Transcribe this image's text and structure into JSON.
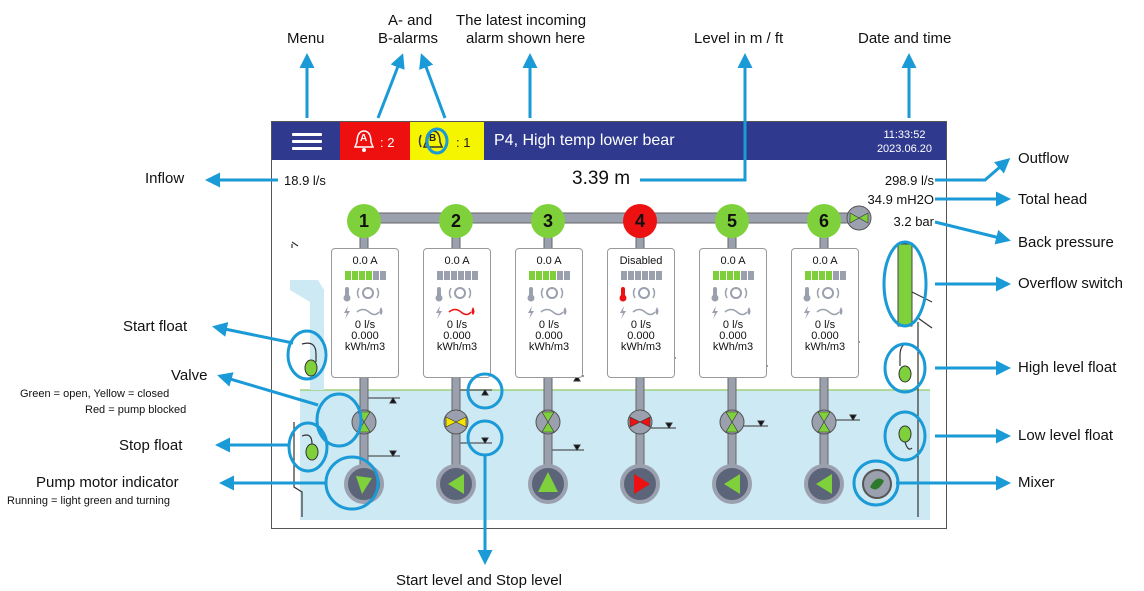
{
  "callouts": {
    "menu": "Menu",
    "alarms": [
      "A- and",
      "B-alarms"
    ],
    "latest_alarm": [
      "The latest incoming",
      "alarm shown here"
    ],
    "level": "Level in m / ft",
    "datetime": "Date and time",
    "inflow": "Inflow",
    "outflow": "Outflow",
    "total_head": "Total head",
    "back_pressure": "Back pressure",
    "overflow_switch": "Overflow switch",
    "start_float": "Start float",
    "valve": "Valve",
    "valve_legend_1": "Green = open, Yellow = closed",
    "valve_legend_2": "Red = pump blocked",
    "stop_float": "Stop float",
    "pump_motor": "Pump motor indicator",
    "pump_motor_legend": "Running = light green and turning",
    "high_float": "High level float",
    "low_float": "Low level float",
    "mixer": "Mixer",
    "start_stop_level": "Start level and Stop level"
  },
  "header": {
    "alarm_a_icon": "A",
    "alarm_a_count": ": 2",
    "alarm_b_icon": "B",
    "alarm_b_count": ": 1",
    "latest_alarm": "P4, High temp lower bear",
    "time": "11:33:52",
    "date": "2023.06.20"
  },
  "readings": {
    "inflow": "18.9 l/s",
    "level": "3.39 m",
    "outflow": "298.9 l/s",
    "total_head": "34.9 mH2O",
    "back_pressure": "3.2 bar"
  },
  "colors": {
    "topbar": "#2f3a8f",
    "alarm_a": "#ee0f0f",
    "alarm_b": "#f5f500",
    "pump_ok": "#7fd13b",
    "pump_alarm": "#ee1111",
    "water": "#cde9f3",
    "valve_open": "#7fd13b",
    "valve_closed": "#f5e400",
    "valve_blocked": "#ee1111",
    "callout": "#1a9ad6"
  },
  "pumps": [
    {
      "number": "1",
      "status_color": "#7fd13b",
      "current": "0.0 A",
      "bars_on": 4,
      "flow": "0 l/s",
      "energy": "0.000",
      "energy_unit": "kWh/m3",
      "valve": "open",
      "motor": "running",
      "warn": false
    },
    {
      "number": "2",
      "status_color": "#7fd13b",
      "current": "0.0 A",
      "bars_on": 0,
      "flow": "0 l/s",
      "energy": "0.000",
      "energy_unit": "kWh/m3",
      "valve": "closed",
      "motor": "stopped",
      "warn": true
    },
    {
      "number": "3",
      "status_color": "#7fd13b",
      "current": "0.0 A",
      "bars_on": 4,
      "flow": "0 l/s",
      "energy": "0.000",
      "energy_unit": "kWh/m3",
      "valve": "open",
      "motor": "running",
      "warn": false
    },
    {
      "number": "4",
      "status_color": "#ee1111",
      "current": "Disabled",
      "bars_on": 0,
      "flow": "0 l/s",
      "energy": "0.000",
      "energy_unit": "kWh/m3",
      "valve": "blocked",
      "motor": "alarm",
      "warn": false,
      "temp_alarm": true
    },
    {
      "number": "5",
      "status_color": "#7fd13b",
      "current": "0.0 A",
      "bars_on": 4,
      "flow": "0 l/s",
      "energy": "0.000",
      "energy_unit": "kWh/m3",
      "valve": "open",
      "motor": "running",
      "warn": false
    },
    {
      "number": "6",
      "status_color": "#7fd13b",
      "current": "0.0 A",
      "bars_on": 4,
      "flow": "0 l/s",
      "energy": "0.000",
      "energy_unit": "kWh/m3",
      "valve": "open",
      "motor": "running",
      "warn": false
    }
  ],
  "icons": [
    "menu-icon",
    "bell-icon",
    "thermometer-icon",
    "vibration-icon",
    "lightning-icon",
    "leak-icon",
    "valve-icon",
    "pump-motor-icon",
    "float-icon",
    "mixer-icon",
    "arrow-up-icon",
    "arrow-down-icon"
  ]
}
